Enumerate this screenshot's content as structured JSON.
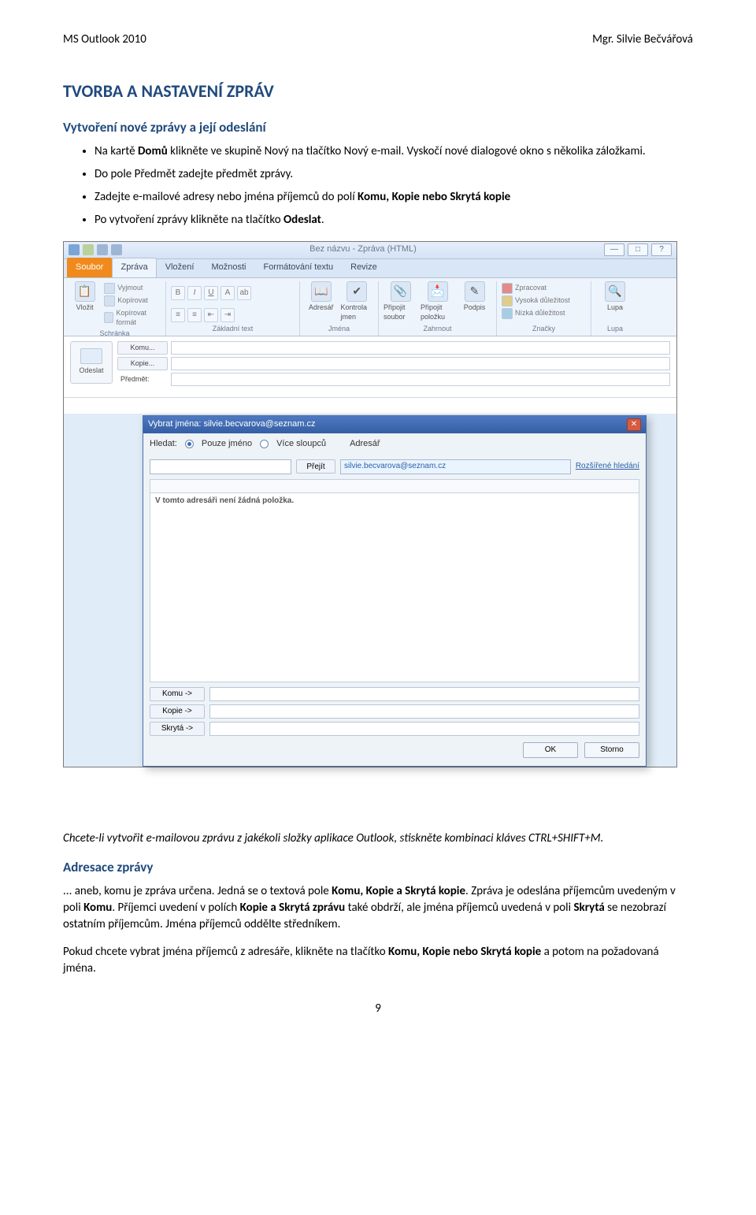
{
  "header": {
    "left": "MS Outlook 2010",
    "right": "Mgr. Silvie Bečvářová"
  },
  "h1": "TVORBA A NASTAVENÍ ZPRÁV",
  "h2_create": "Vytvoření nové zprávy a její odeslání",
  "bullets": {
    "b1_pre": "Na kartě ",
    "b1_domu": "Domů",
    "b1_mid": " klikněte ve skupině Nový na tlačítko Nový e-mail. Vyskočí nové dialogové okno s několika záložkami.",
    "b2": "Do pole Předmět zadejte předmět zprávy.",
    "b3_pre": "Zadejte e-mailové adresy nebo jména příjemců do polí ",
    "b3_fields": "Komu, Kopie nebo Skrytá kopie",
    "b4_pre": "Po vytvoření zprávy klikněte na tlačítko ",
    "b4_btn": "Odeslat",
    "b4_post": "."
  },
  "screenshot": {
    "qat_title": "Bez názvu - Zpráva (HTML)",
    "tabs": {
      "file": "Soubor",
      "sprava": "Zpráva",
      "vlozeni": "Vložení",
      "moznosti": "Možnosti",
      "format": "Formátování textu",
      "revize": "Revize"
    },
    "win": {
      "min": "—",
      "max": "□",
      "help": "?"
    },
    "ribbon": {
      "vlozit": "Vložit",
      "vyjmout": "Vyjmout",
      "kopirovat": "Kopírovat",
      "kopirovat_format": "Kopírovat formát",
      "grp_schranka": "Schránka",
      "grp_text": "Základní text",
      "adresar": "Adresář",
      "kontrola": "Kontrola jmen",
      "grp_jmena": "Jména",
      "pripojit_soubor": "Připojit soubor",
      "pripojit_polozku": "Připojit položku",
      "podpis": "Podpis",
      "grp_zahrnout": "Zahrnout",
      "zpracovat": "Zpracovat",
      "vysoka": "Vysoká důležitost",
      "nizka": "Nízká důležitost",
      "grp_znacky": "Značky",
      "lupa": "Lupa",
      "grp_lupa": "Lupa"
    },
    "send": "Odeslat",
    "komu": "Komu...",
    "kopie": "Kopie...",
    "predmet": "Předmět:",
    "dialog": {
      "title": "Vybrat jména: silvie.becvarova@seznam.cz",
      "hledat": "Hledat:",
      "radio1": "Pouze jméno",
      "radio2": "Více sloupců",
      "adresar_lbl": "Adresář",
      "prejit": "Přejít",
      "abook_value": "silvie.becvarova@seznam.cz",
      "rozs": "Rozšířené hledání",
      "empty": "V tomto adresáři není žádná položka.",
      "dest_komu": "Komu ->",
      "dest_kopie": "Kopie ->",
      "dest_skryta": "Skrytá ->",
      "ok": "OK",
      "storno": "Storno"
    }
  },
  "tip": "Chcete-li vytvořit e-mailovou zprávu z jakékoli složky aplikace Outlook, stiskněte kombinaci kláves CTRL+SHIFT+M.",
  "h2_adresace": "Adresace zprávy",
  "para1_pre": "... aneb, komu je zpráva určena. Jedná se o textová pole ",
  "para1_b1": "Komu, Kopie a Skrytá kopie",
  "para1_mid": ". Zpráva je odeslána příjemcům uvedeným v poli ",
  "para1_b2": "Komu",
  "para1_mid2": ". Příjemci uvedení v polích ",
  "para1_b3": "Kopie a Skrytá zprávu",
  "para1_mid3": " také obdrží, ale jména příjemců uvedená v poli ",
  "para1_b4": "Skrytá",
  "para1_end": " se nezobrazí ostatním příjemcům. Jména příjemců oddělte středníkem.",
  "para2_pre": "Pokud chcete vybrat jména příjemců z adresáře, klikněte na tlačítko ",
  "para2_b1": "Komu, Kopie nebo Skrytá kopie",
  "para2_end": " a potom na požadovaná jména.",
  "page_no": "9"
}
